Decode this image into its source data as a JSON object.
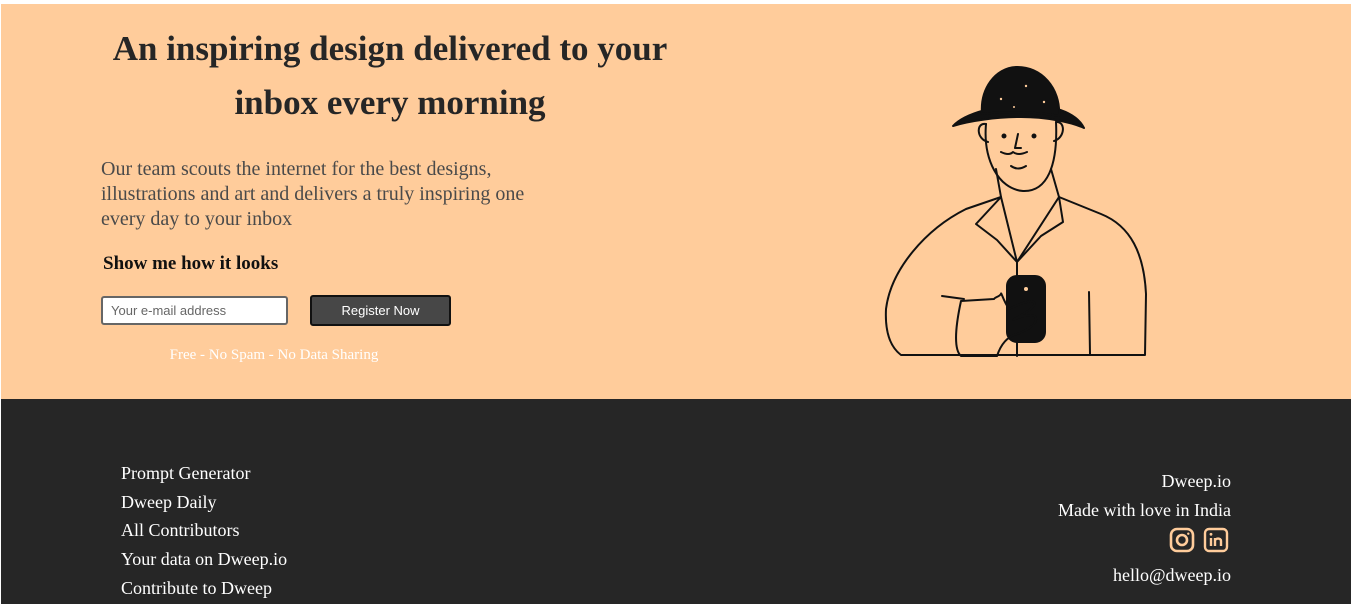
{
  "hero": {
    "headline": "An inspiring design delivered to your inbox every morning",
    "description": "Our team scouts the internet for the best designs, illustrations and art and delivers a truly inspiring one every day to your inbox",
    "cta_heading": "Show me how it looks",
    "email_placeholder": "Your e-mail address",
    "register_label": "Register Now",
    "tagline": "Free - No Spam - No Data Sharing",
    "illustration_icon": "man-with-hat-holding-phone-illustration"
  },
  "footer": {
    "links": [
      {
        "label": "Prompt Generator"
      },
      {
        "label": "Dweep Daily"
      },
      {
        "label": "All Contributors"
      },
      {
        "label": "Your data on Dweep.io"
      },
      {
        "label": "Contribute to Dweep"
      }
    ],
    "brand": "Dweep.io",
    "made_with": "Made with love in India",
    "socials": [
      {
        "icon": "instagram-icon"
      },
      {
        "icon": "linkedin-icon"
      }
    ],
    "email": "hello@dweep.io"
  },
  "colors": {
    "hero_bg": "#ffcc9b",
    "footer_bg": "#262626",
    "button_bg": "#474747",
    "social_icon": "#ffcc9b"
  }
}
